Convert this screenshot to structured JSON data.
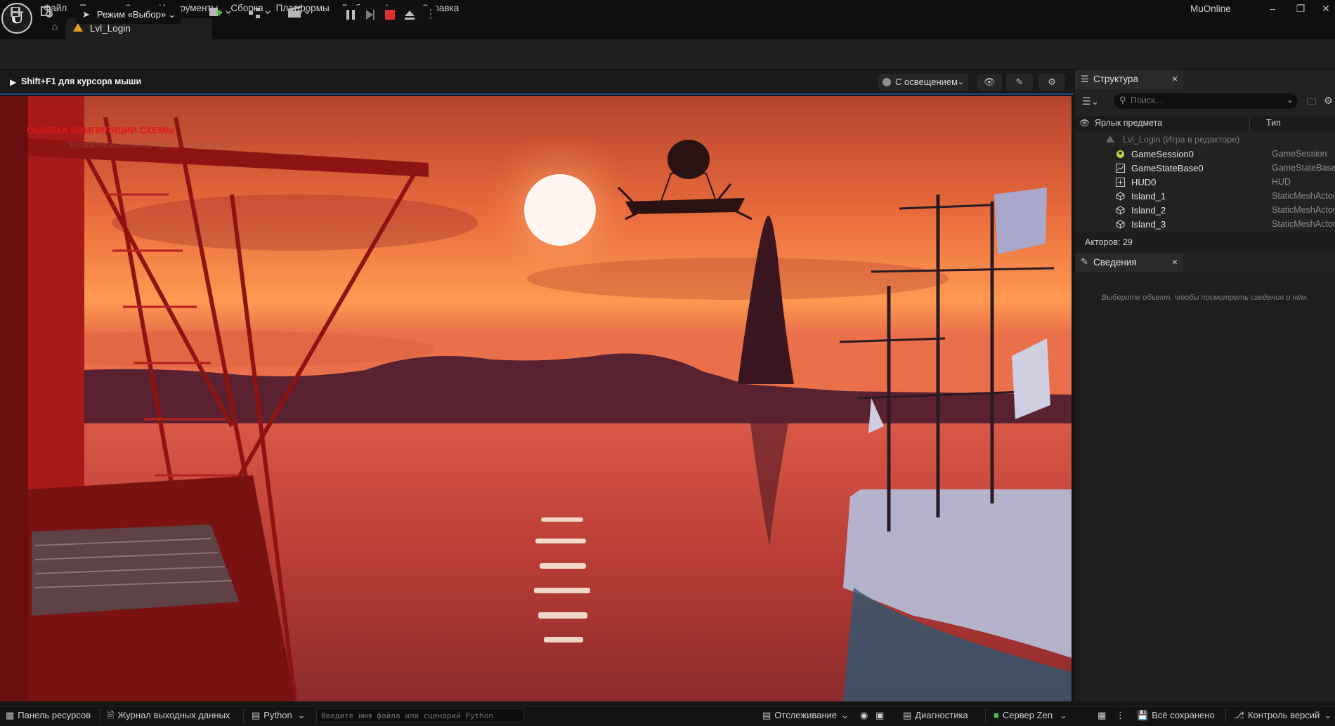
{
  "menu": [
    "Файл",
    "Правка",
    "Окно",
    "Инструменты",
    "Сборка",
    "Платформы",
    "Выбор",
    "Актор",
    "Справка"
  ],
  "project_name": "MuOnline",
  "level_tab": "Lvl_Login",
  "toolbar": {
    "mode_label": "Режим «Выбор»"
  },
  "viewport": {
    "hint": "Shift+F1 для курсора мыши",
    "lit_label": "С освещением",
    "compile_error": "ОШИБКА КОМПИЛЯЦИИ СХЕМЫ",
    "compile_hint": "\"DisableAllScreenMessages\", чтобы скрыть"
  },
  "outliner": {
    "title": "Структура",
    "search_placeholder": "Поиск...",
    "col_label": "Ярлык предмета",
    "col_type": "Тип",
    "root": "Lvl_Login (Игра в редакторе)",
    "rows": [
      {
        "name": "GameSession0",
        "type": "GameSession",
        "icon": "game-session-icon",
        "color": "#b9d24a"
      },
      {
        "name": "GameStateBase0",
        "type": "GameStateBase",
        "icon": "game-state-icon",
        "color": "#cfcfcf"
      },
      {
        "name": "HUD0",
        "type": "HUD",
        "icon": "hud-icon",
        "color": "#cfcfcf"
      },
      {
        "name": "Island_1",
        "type": "StaticMeshActor",
        "icon": "static-mesh-icon",
        "color": "#cfcfcf"
      },
      {
        "name": "Island_2",
        "type": "StaticMeshActor",
        "icon": "static-mesh-icon",
        "color": "#cfcfcf"
      },
      {
        "name": "Island_3",
        "type": "StaticMeshActor",
        "icon": "static-mesh-icon",
        "color": "#cfcfcf"
      }
    ],
    "actor_count": "Акторов: 29"
  },
  "details": {
    "title": "Сведения",
    "empty_text": "Выберите объект, чтобы посмотреть сведения о нём."
  },
  "statusbar": {
    "content_drawer": "Панель ресурсов",
    "output_log": "Журнал выходных данных",
    "cmd": "Python",
    "py_placeholder": "Введите имя файла или сценарий Python",
    "trace": "Отслеживание",
    "diagnostics": "Диагностика",
    "zen": "Сервер Zen",
    "saved": "Всё сохранено",
    "revision": "Контроль версий"
  },
  "colors": {
    "accent": "#1b4d86",
    "stop": "#e03131",
    "error": "#e01818",
    "sky_top": "#c14a2c",
    "sky_horizon": "#ff8a3c",
    "water": "#c4423a"
  }
}
